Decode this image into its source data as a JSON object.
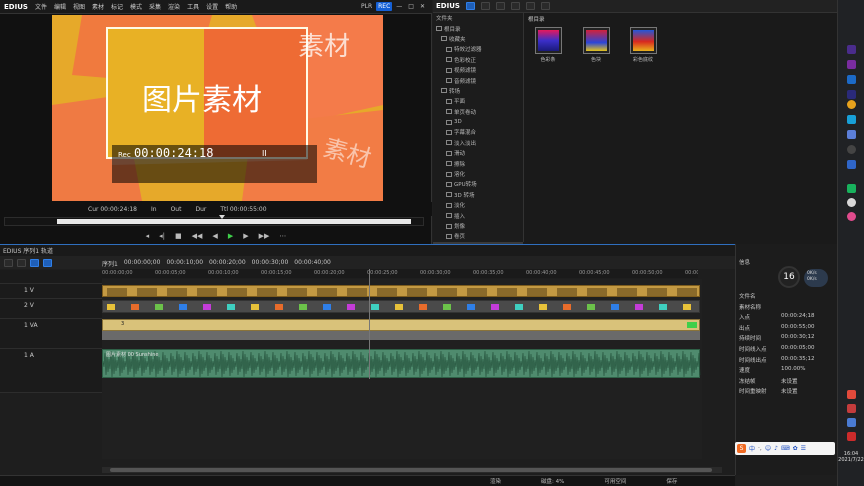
{
  "player": {
    "brand": "EDIUS",
    "menu": [
      "文件",
      "编辑",
      "视图",
      "素材",
      "标记",
      "模式",
      "采集",
      "渲染",
      "工具",
      "设置",
      "帮助"
    ],
    "plr_label": "PLR",
    "rec_label": "REC",
    "video_text_main": "图片素材",
    "video_text_tile": "素材",
    "rec_prefix": "Rec",
    "timecode": "00:00:24:18",
    "pause_symbol": "II",
    "cur_label": "Cur 00:00:24:18",
    "in_label": "In",
    "out_label": "Out",
    "dur_label": "Dur",
    "ttl_label": "Ttl 00:00:55:00",
    "transport": [
      "◂",
      "◂|",
      "■",
      "◀◀",
      "◀",
      "▶",
      "▶",
      "▶▶",
      "⋯"
    ]
  },
  "bin": {
    "brand": "EDIUS",
    "tree_header": "文件夹",
    "tree": [
      "根目录",
      "收藏夹",
      "特效过滤器",
      "色彩校正",
      "视频滤镜",
      "音频滤镜",
      "转场",
      "平面",
      "单页卷动",
      "3D",
      "字幕混合",
      "淡入淡出",
      "滑动",
      "擦除",
      "溶化",
      "GPU转场",
      "3D 转场",
      "淡化",
      "插入",
      "划像",
      "卷页",
      "键"
    ],
    "path_label": "根目录",
    "clips": [
      "色彩条",
      "色块",
      "彩色底纹"
    ]
  },
  "timeline": {
    "title": "EDIUS 序列1 轨道",
    "tabs": [
      "序列1",
      "00:00:00;00",
      "00:00:10;00",
      "00:00:20;00",
      "00:00:30;00",
      "00:00:40;00"
    ],
    "ruler": [
      "00:00:00;00",
      "00:00:05;00",
      "00:00:10;00",
      "00:00:15;00",
      "00:00:20;00",
      "00:00:25;00",
      "00:00:30;00",
      "00:00:35;00",
      "00:00:40;00",
      "00:00:45;00",
      "00:00:50;00",
      "00:00:55;00"
    ],
    "tracks": [
      {
        "name": "1 V"
      },
      {
        "name": "2 V"
      },
      {
        "name": "1 VA"
      },
      {
        "name": "1 A"
      }
    ],
    "audio_clip_label": "图片素材 00 Sunshine",
    "v1_clip_label": "3",
    "status": [
      "渲染",
      "磁盘: 4%",
      "可用空间",
      "保存"
    ]
  },
  "info": {
    "header": "信息",
    "rows": [
      {
        "k": "文件名",
        "v": ""
      },
      {
        "k": "素材名称",
        "v": ""
      },
      {
        "k": "入点",
        "v": "00:00:24;18"
      },
      {
        "k": "出点",
        "v": "00:00:55;00"
      },
      {
        "k": "持续时间",
        "v": "00:00:30;12"
      },
      {
        "k": "时间线入点",
        "v": "00:00:05;00"
      },
      {
        "k": "时间线出点",
        "v": "00:00:35;12"
      },
      {
        "k": "速度",
        "v": "100.00%"
      },
      {
        "k": "冻结帧",
        "v": "未设置"
      },
      {
        "k": "时间重映射",
        "v": "未设置"
      }
    ],
    "gauge_value": "16",
    "gauge_side": [
      "0K/s",
      "0K/s"
    ]
  },
  "os": {
    "clock_time": "16:04",
    "clock_date": "2021/7/22"
  }
}
